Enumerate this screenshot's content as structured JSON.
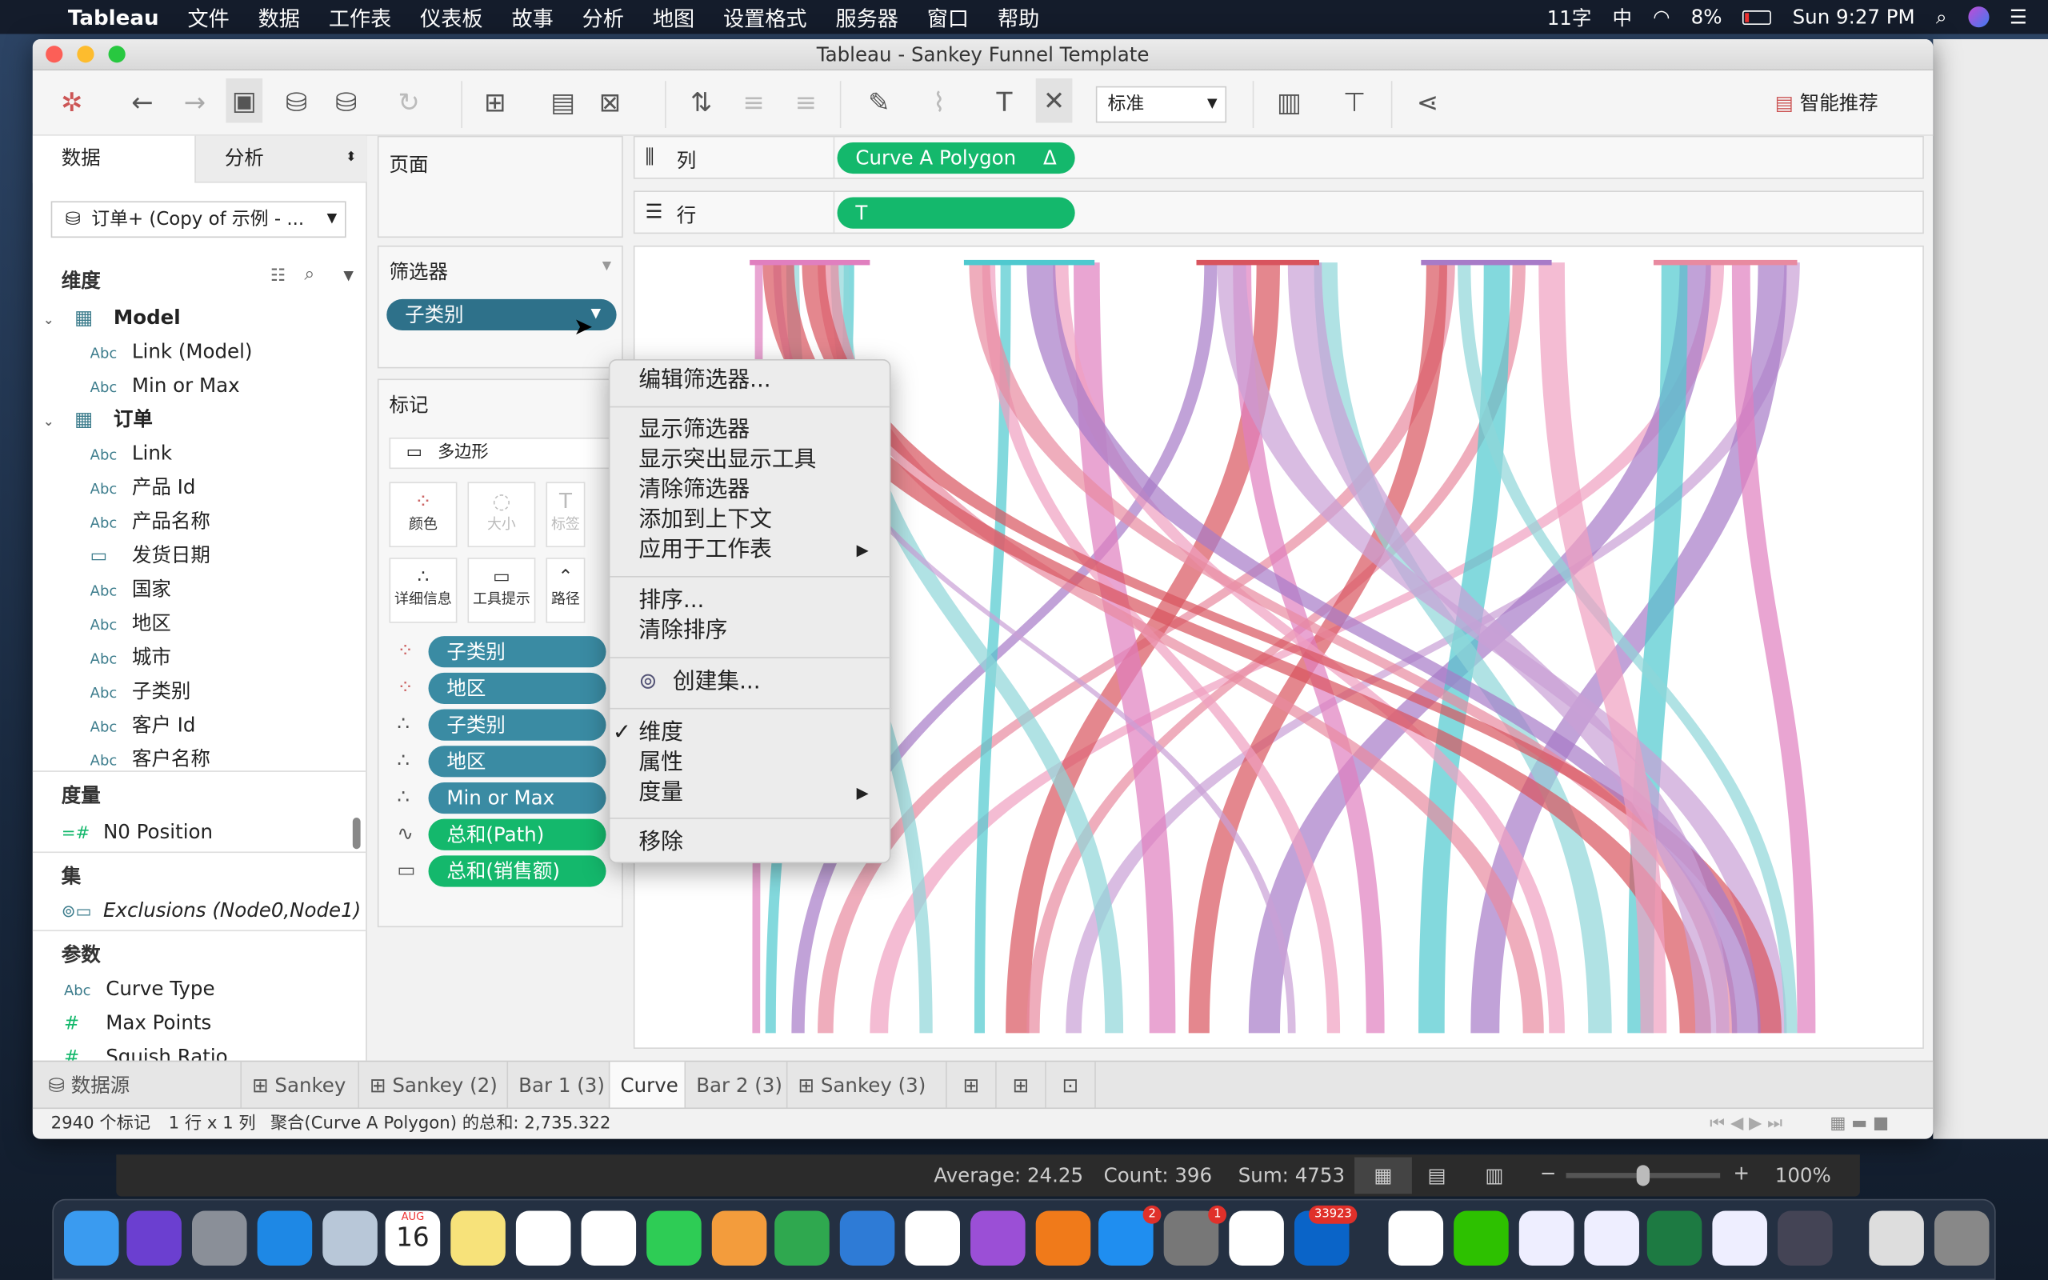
{
  "menubar": {
    "apple": "",
    "app": "Tableau",
    "items": [
      "文件",
      "数据",
      "工作表",
      "仪表板",
      "故事",
      "分析",
      "地图",
      "设置格式",
      "服务器",
      "窗口",
      "帮助"
    ],
    "input_count": "11字",
    "ime": "中",
    "battery": "8%",
    "clock": "Sun 9:27 PM"
  },
  "window": {
    "title": "Tableau - Sankey Funnel Template"
  },
  "toolbar": {
    "fit_select": "标准",
    "smart_recommend": "智能推荐"
  },
  "left_panel": {
    "tabs": [
      "数据",
      "分析"
    ],
    "datasource": "订单+ (Copy of 示例 - ...",
    "dimensions_header": "维度",
    "tables": [
      {
        "name": "Model",
        "fields": [
          {
            "type": "Abc",
            "name": "Link (Model)"
          },
          {
            "type": "Abc",
            "name": "Min or Max"
          }
        ]
      },
      {
        "name": "订单",
        "fields": [
          {
            "type": "Abc",
            "name": "Link"
          },
          {
            "type": "Abc",
            "name": "产品 Id"
          },
          {
            "type": "Abc",
            "name": "产品名称"
          },
          {
            "type": "date",
            "name": "发货日期"
          },
          {
            "type": "Abc",
            "name": "国家"
          },
          {
            "type": "Abc",
            "name": "地区"
          },
          {
            "type": "Abc",
            "name": "城市"
          },
          {
            "type": "Abc",
            "name": "子类别"
          },
          {
            "type": "Abc",
            "name": "客户 Id"
          },
          {
            "type": "Abc",
            "name": "客户名称"
          }
        ]
      }
    ],
    "measures_header": "度量",
    "measures": [
      "N0 Position"
    ],
    "sets_header": "集",
    "sets": [
      "Exclusions (Node0,Node1)"
    ],
    "params_header": "参数",
    "params": [
      {
        "type": "Abc",
        "name": "Curve Type"
      },
      {
        "type": "#",
        "name": "Max Points"
      },
      {
        "type": "#",
        "name": "Squish Ratio"
      }
    ]
  },
  "pages": {
    "title": "页面"
  },
  "filters": {
    "title": "筛选器",
    "pill": "子类别"
  },
  "marks": {
    "title": "标记",
    "type": "多边形",
    "buttons": [
      "颜色",
      "大小",
      "标签",
      "详细信息",
      "工具提示",
      "路径"
    ],
    "pills": [
      {
        "icon": "color",
        "label": "子类别"
      },
      {
        "icon": "color",
        "label": "地区"
      },
      {
        "icon": "detail",
        "label": "子类别"
      },
      {
        "icon": "detail",
        "label": "地区"
      },
      {
        "icon": "detail",
        "label": "Min or Max"
      },
      {
        "icon": "path",
        "label": "总和(Path)"
      },
      {
        "icon": "tooltip",
        "label": "总和(销售额)"
      }
    ]
  },
  "shelves": {
    "columns_label": "列",
    "columns_pill": "Curve A Polygon",
    "columns_pill_delta": "Δ",
    "rows_label": "行",
    "rows_pill": "T"
  },
  "context_menu": {
    "items": [
      "编辑筛选器...",
      "显示筛选器",
      "显示突出显示工具",
      "清除筛选器",
      "添加到上下文",
      "应用于工作表",
      "排序...",
      "清除排序",
      "创建集...",
      "维度",
      "属性",
      "度量",
      "移除"
    ],
    "checked": "维度",
    "check": "✓"
  },
  "sheet_tabs": {
    "datasource": "数据源",
    "tabs": [
      "Sankey",
      "Sankey (2)",
      "Bar 1 (3)",
      "Curve",
      "Bar 2 (3)",
      "Sankey (3)"
    ],
    "active": "Curve"
  },
  "status": {
    "marks": "2940 个标记",
    "rows_cols": "1 行 x 1 列",
    "sum": "聚合(Curve A Polygon) 的总和: 2,735.322"
  },
  "excel_status": {
    "average": "Average: 24.25",
    "count": "Count: 396",
    "sum": "Sum: 4753",
    "zoom": "100%"
  },
  "dock": {
    "calendar_month": "AUG",
    "calendar_day": "16",
    "badges": {
      "app_store": "2",
      "system_prefs": "1",
      "outlook": "33923"
    }
  },
  "viz_colors": [
    "#e07fbf",
    "#4fc9cf",
    "#d8545e",
    "#a77bc8",
    "#e88aa0",
    "#c9a0d6",
    "#f0a0c0",
    "#8fd6d8"
  ]
}
